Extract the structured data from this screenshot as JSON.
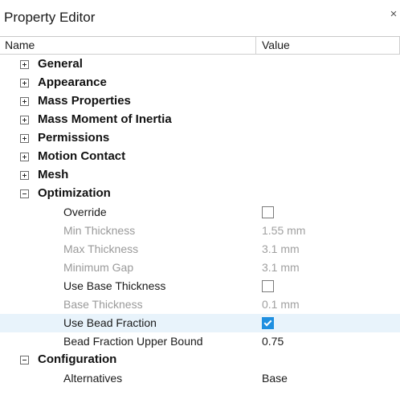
{
  "window": {
    "title": "Property Editor",
    "close_glyph": "×"
  },
  "columns": {
    "name": "Name",
    "value": "Value"
  },
  "groups": [
    {
      "label": "General",
      "expanded": false
    },
    {
      "label": "Appearance",
      "expanded": false
    },
    {
      "label": "Mass Properties",
      "expanded": false
    },
    {
      "label": "Mass Moment of Inertia",
      "expanded": false
    },
    {
      "label": "Permissions",
      "expanded": false
    },
    {
      "label": "Motion Contact",
      "expanded": false
    },
    {
      "label": "Mesh",
      "expanded": false
    },
    {
      "label": "Optimization",
      "expanded": true
    },
    {
      "label": "Configuration",
      "expanded": true
    }
  ],
  "optimization": [
    {
      "label": "Override",
      "type": "checkbox",
      "checked": false,
      "enabled": true
    },
    {
      "label": "Min Thickness",
      "type": "text",
      "value": "1.55 mm",
      "enabled": false
    },
    {
      "label": "Max Thickness",
      "type": "text",
      "value": "3.1 mm",
      "enabled": false
    },
    {
      "label": "Minimum Gap",
      "type": "text",
      "value": "3.1 mm",
      "enabled": false
    },
    {
      "label": "Use Base Thickness",
      "type": "checkbox",
      "checked": false,
      "enabled": true
    },
    {
      "label": "Base Thickness",
      "type": "text",
      "value": "0.1 mm",
      "enabled": false
    },
    {
      "label": "Use Bead Fraction",
      "type": "checkbox",
      "checked": true,
      "enabled": true,
      "selected": true
    },
    {
      "label": "Bead Fraction Upper Bound",
      "type": "text",
      "value": "0.75",
      "enabled": true
    }
  ],
  "configuration": [
    {
      "label": "Alternatives",
      "type": "text",
      "value": "Base",
      "enabled": true
    }
  ],
  "colors": {
    "accent": "#1f8fe0",
    "selected_row": "#e8f3fb",
    "disabled_text": "#9a9a9a"
  }
}
